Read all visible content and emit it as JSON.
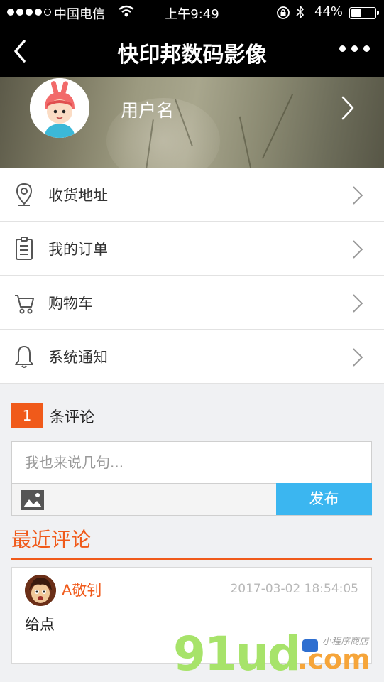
{
  "status_bar": {
    "carrier": "中国电信",
    "time": "上午9:49",
    "battery_pct": "44%",
    "battery_level": 0.44
  },
  "nav": {
    "title": "快印邦数码影像",
    "back_icon": "chevron-left-icon",
    "more_icon": "more-dots-icon"
  },
  "profile": {
    "username": "用户名"
  },
  "menu": [
    {
      "label": "收货地址",
      "icon": "location-pin-icon"
    },
    {
      "label": "我的订单",
      "icon": "order-list-icon"
    },
    {
      "label": "购物车",
      "icon": "shopping-cart-icon"
    },
    {
      "label": "系统通知",
      "icon": "bell-icon"
    }
  ],
  "comments": {
    "count": "1",
    "count_label": "条评论",
    "input_placeholder": "我也来说几句...",
    "publish_label": "发布",
    "recent_title": "最近评论",
    "list": [
      {
        "author": "A敬钊",
        "date": "2017-03-02 18:54:05",
        "body": "给点"
      }
    ]
  },
  "watermark": {
    "brand": "91ud",
    "tld": ".com",
    "sub": "小程序商店"
  },
  "colors": {
    "accent": "#f05a1a",
    "publish": "#3bb6f0",
    "watermark_green": "#a7e36a",
    "watermark_orange": "#f6a53a"
  }
}
